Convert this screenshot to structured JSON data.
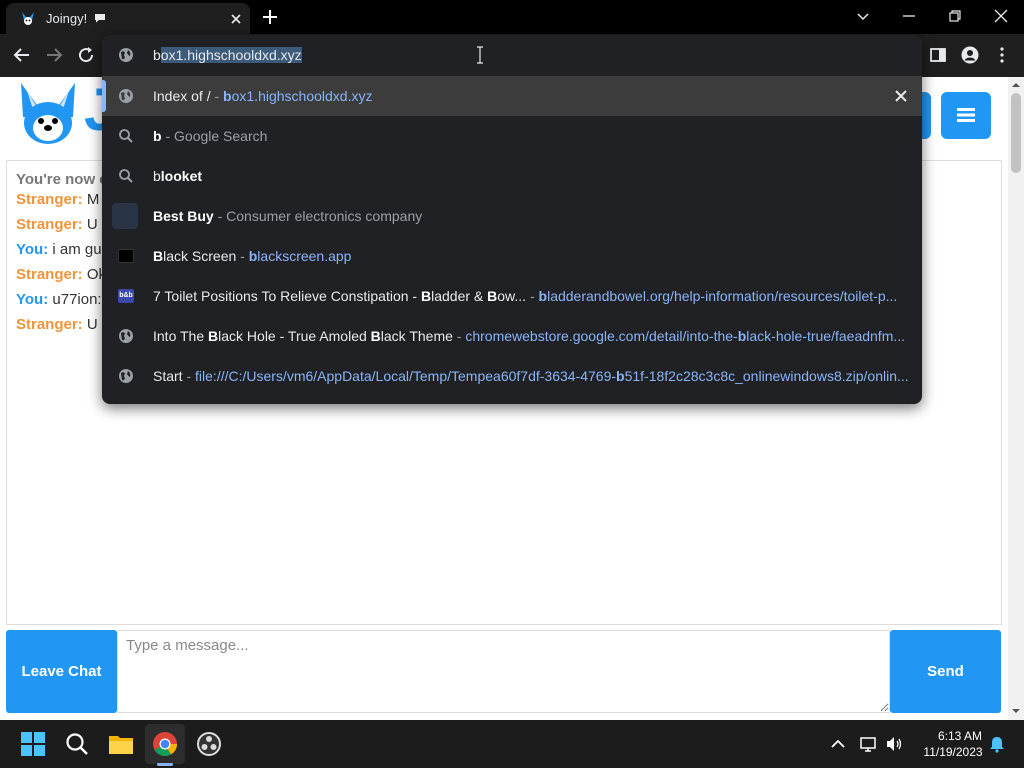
{
  "tab": {
    "title": "Joingy!"
  },
  "omnibox": {
    "typed": "b",
    "autocomplete": "ox1.highschooldxd.xyz",
    "suggestions": [
      {
        "title": "Index of /",
        "sep": " - ",
        "url_bold": "b",
        "url_rest": "ox1.highschooldxd.xyz"
      },
      {
        "title_bold": "b",
        "sep": " - ",
        "desc": "Google Search"
      },
      {
        "title_bold1": "b",
        "title_rest_bold": "looket"
      },
      {
        "title_b1": "B",
        "title_r1": "est Buy",
        "sep": " - ",
        "desc": "Consumer electronics company"
      },
      {
        "title_b1": "B",
        "title_r1": "lack Screen",
        "sep": " - ",
        "url_bold": "b",
        "url_rest": "lackscreen.app"
      },
      {
        "pre": "7 Toilet Positions To Relieve Constipation - ",
        "b1": "B",
        "mid1": "ladder & ",
        "b2": "B",
        "mid2": "ow...",
        "sep": "  - ",
        "url_bold": "b",
        "url_rest": "ladderandbowel.org/help-information/resources/toilet-p...",
        "fav_label": "b&b"
      },
      {
        "pre": "Into The ",
        "b1": "B",
        "mid1": "lack Hole - True Amoled ",
        "b2": "B",
        "mid2": "lack Theme",
        "sep": " - ",
        "url_pre": "chromewebstore.google.com/detail/into-the-",
        "url_bold": "b",
        "url_rest": "lack-hole-true/faeadnfm..."
      },
      {
        "title": "Start",
        "sep": " - ",
        "url_pre": "file:///C:/Users/vm6/AppData/Local/Temp/Tempea60f7df-3634-4769-",
        "url_bold": "b",
        "url_rest": "51f-18f2c28c3c8c_onlinewindows8.zip/onlin..."
      }
    ]
  },
  "site": {
    "logo_letter": "J",
    "chat": [
      {
        "type": "status",
        "text": "You're now c"
      },
      {
        "who": "Stranger:",
        "role": "stranger",
        "text": " M"
      },
      {
        "who": "Stranger:",
        "role": "stranger",
        "text": " U l"
      },
      {
        "who": "You:",
        "role": "you",
        "text": " i am gue"
      },
      {
        "who": "Stranger:",
        "role": "stranger",
        "text": " Ok"
      },
      {
        "who": "You:",
        "role": "you",
        "text": " u77ion:"
      },
      {
        "who": "Stranger:",
        "role": "stranger",
        "text": " U l"
      }
    ],
    "leave_label": "Leave Chat",
    "send_label": "Send",
    "message_placeholder": "Type a message..."
  },
  "taskbar": {
    "time": "6:13 AM",
    "date": "11/19/2023"
  },
  "colors": {
    "brand_blue": "#2196f3",
    "stranger_orange": "#f0943a",
    "link_blue": "#8ab4f8"
  }
}
